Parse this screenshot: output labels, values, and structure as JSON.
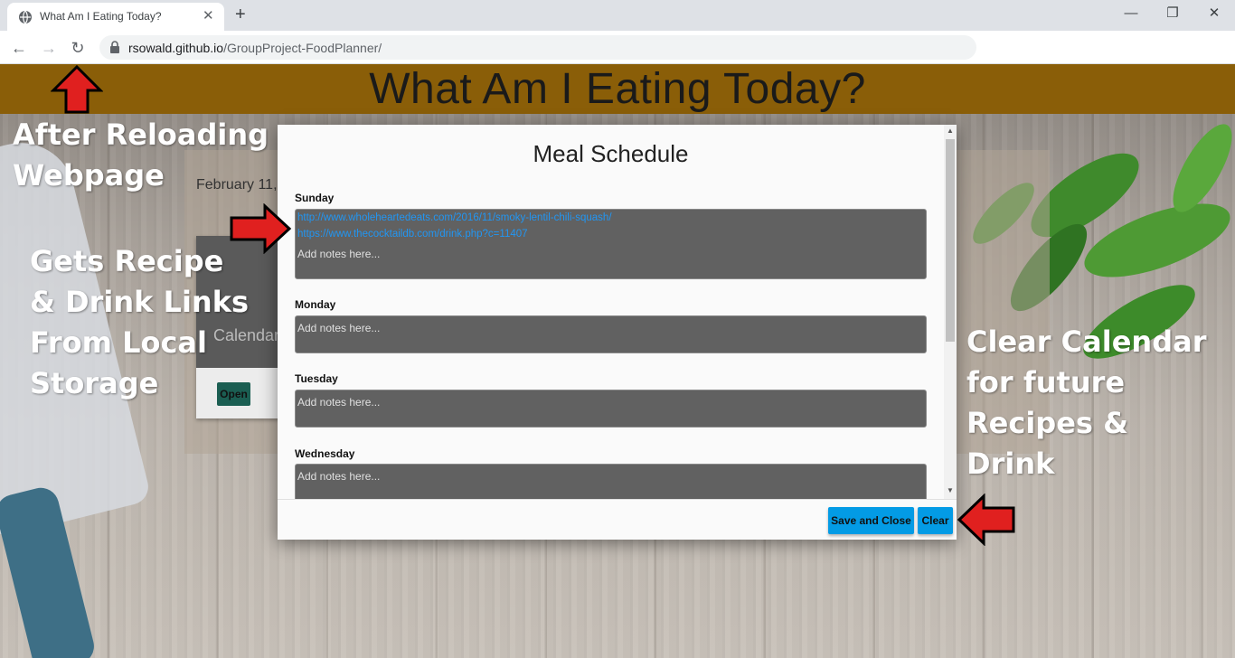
{
  "browser": {
    "tab_title": "What Am I Eating Today?",
    "tab_close": "✕",
    "new_tab": "+",
    "minimize": "—",
    "restore": "❐",
    "close": "✕",
    "back": "←",
    "forward": "→",
    "reload": "↻",
    "url_host": "rsowald.github.io",
    "url_path": "/GroupProject-FoodPlanner/"
  },
  "page": {
    "site_title": "What Am I Eating Today?",
    "date_text": "February 11,",
    "card_label": "Calendar",
    "card_open_button": "Open"
  },
  "annotations": {
    "reload_line1": "After Reloading",
    "reload_line2": "Webpage",
    "links_line1": "Gets Recipe",
    "links_line2": "& Drink Links",
    "links_line3": "From Local",
    "links_line4": "Storage",
    "clear_line1": "Clear Calendar",
    "clear_line2": "for future",
    "clear_line3": "Recipes &",
    "clear_line4": "Drink"
  },
  "modal": {
    "title": "Meal Schedule",
    "days": [
      {
        "name": "Sunday",
        "links": [
          "http://www.wholeheartedeats.com/2016/11/smoky-lentil-chili-squash/",
          "https://www.thecocktaildb.com/drink.php?c=11407"
        ],
        "placeholder": "Add notes here..."
      },
      {
        "name": "Monday",
        "placeholder": "Add notes here..."
      },
      {
        "name": "Tuesday",
        "placeholder": "Add notes here..."
      },
      {
        "name": "Wednesday",
        "placeholder": "Add notes here..."
      }
    ],
    "save_button": "Save and Close",
    "clear_button": "Clear"
  },
  "colors": {
    "header": "#8a5e08",
    "button": "#039be5",
    "link": "#2196f3",
    "textarea": "#616161",
    "arrow": "#e0201f"
  }
}
